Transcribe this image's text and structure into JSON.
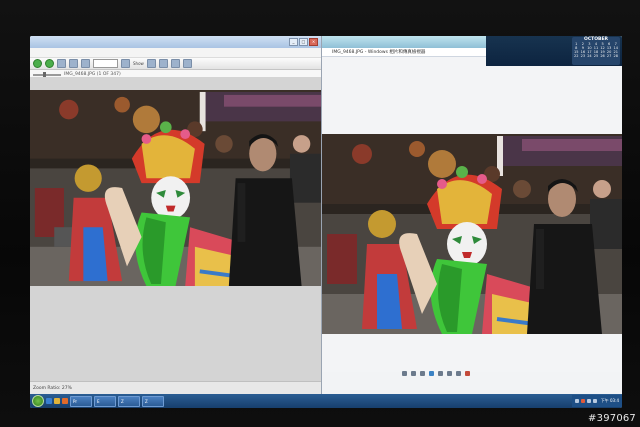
{
  "left_window": {
    "title": "",
    "menu": [
      "",
      "",
      "",
      "",
      ""
    ],
    "zoom_select": "",
    "toolbar_label": "Show",
    "path_text": "IMG_9468.JPG (1 OF 347)",
    "status_text": "Zoom Ratio: 27%"
  },
  "right_window": {
    "title": "",
    "address_text": "IMG_9468.JPG - Windows 相片和傳真檢視器"
  },
  "desktop": {
    "calendar_month": "OCTOBER",
    "calendar_days": [
      "1",
      "2",
      "3",
      "4",
      "5",
      "6",
      "7",
      "8",
      "9",
      "10",
      "11",
      "12",
      "13",
      "14",
      "15",
      "16",
      "17",
      "18",
      "19",
      "20",
      "21",
      "22",
      "23",
      "24",
      "25",
      "26",
      "27",
      "28"
    ]
  },
  "taskbar": {
    "tasks": [
      "Pr",
      "E",
      "Z",
      "Z"
    ],
    "clock": "下午 03:4"
  },
  "watermark": "#397067",
  "colors": {
    "accent": "#2b5d93",
    "title_bar": "#a9c3e3",
    "close": "#d8685a"
  }
}
